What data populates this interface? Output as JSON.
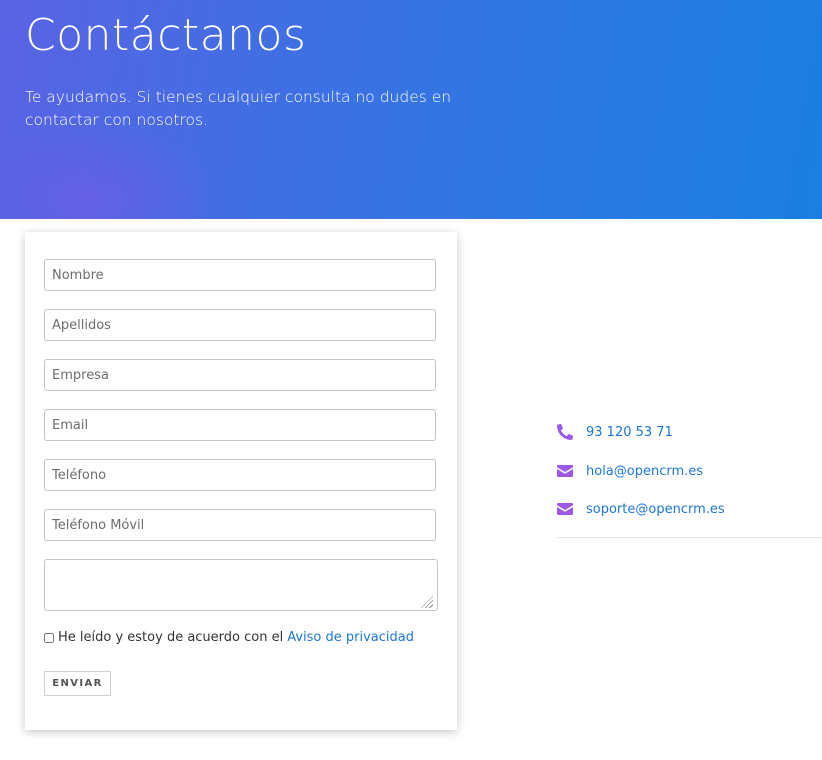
{
  "hero": {
    "title": "Contáctanos",
    "subtitle": "Te ayudamos. Si tienes cualquier consulta no dudes en contactar con nosotros."
  },
  "form": {
    "fields": {
      "nombre": "Nombre",
      "apellidos": "Apellidos",
      "empresa": "Empresa",
      "email": "Email",
      "telefono": "Teléfono",
      "telefono_movil": "Teléfono Móvil"
    },
    "message_value": "",
    "consent_text": "He leído y estoy de acuerdo con el",
    "consent_link": "Aviso de privacidad",
    "submit_label": "ENVIAR"
  },
  "contact": {
    "phone": "93 120 53 71",
    "email_info": "hola@opencrm.es",
    "email_support": "soporte@opencrm.es",
    "icon_names": [
      "phone-icon",
      "envelope-icon",
      "envelope-icon"
    ]
  },
  "colors": {
    "hero_gradient_start": "#5a63e4",
    "hero_gradient_end": "#1b7fe2",
    "link": "#1d77d6",
    "icon": "#9b59e6"
  }
}
